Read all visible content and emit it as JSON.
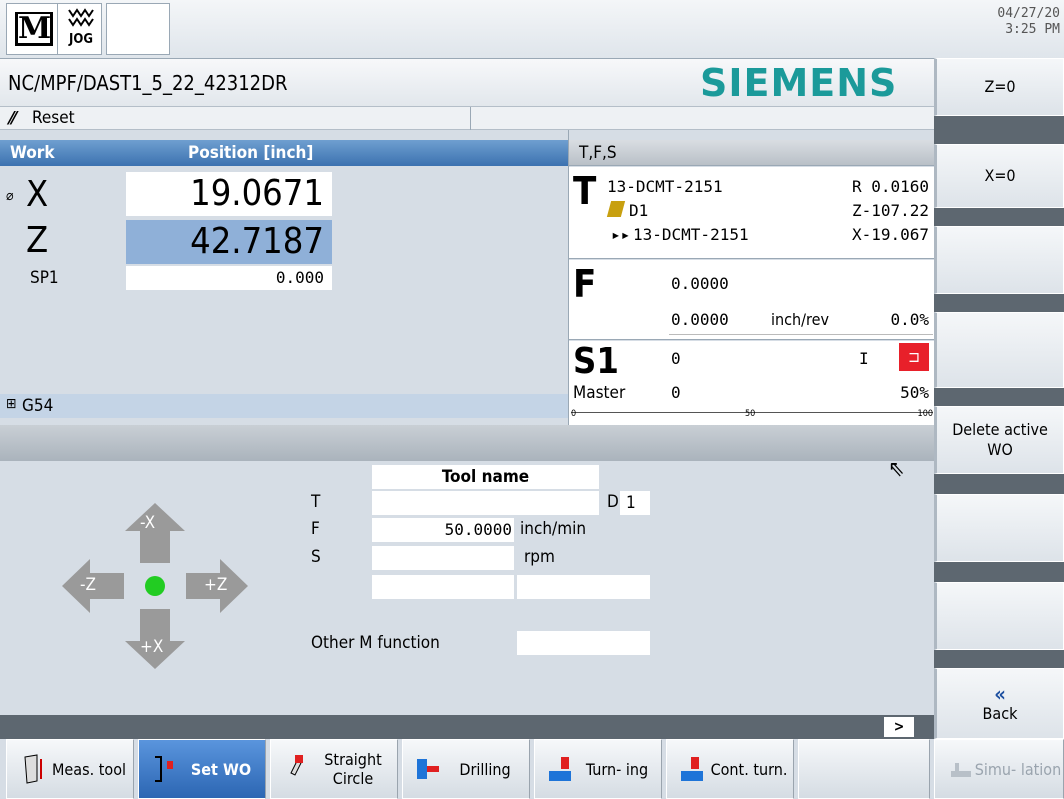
{
  "top": {
    "mode_icon": "M",
    "jog_label": "JOG",
    "date": "04/27/20",
    "time": "3:25 PM"
  },
  "program": {
    "path": "NC/MPF/DAST1_5_22_42312DR",
    "brand": "SIEMENS",
    "status": "Reset"
  },
  "position": {
    "header_work": "Work",
    "header_pos": "Position [inch]",
    "axes": [
      {
        "name": "X",
        "value": "19.0671",
        "marker": "⌀"
      },
      {
        "name": "Z",
        "value": "42.7187"
      }
    ],
    "spindle_label": "SP1",
    "spindle_value": "0.000",
    "wo": "G54"
  },
  "tfs": {
    "header": "T,F,S",
    "t_label": "T",
    "tool": "13-DCMT-2151",
    "d": "D1",
    "next_tool": "13-DCMT-2151",
    "r": "R 0.0160",
    "z": "Z-107.22",
    "x": "X-19.067",
    "f_label": "F",
    "f1": "0.0000",
    "f2": "0.0000",
    "f_unit": "inch/rev",
    "f_pct": "0.0%",
    "s_label": "S1",
    "s_val": "0",
    "s_dir": "I",
    "master_label": "Master",
    "master_val": "0",
    "master_pct": "50%",
    "scale": [
      "0",
      "50",
      "100"
    ]
  },
  "form": {
    "tool_name_header": "Tool name",
    "t": "T",
    "d_label": "D",
    "d_value": "1",
    "f": "F",
    "f_value": "50.0000",
    "f_unit": "inch/min",
    "s": "S",
    "s_unit": "rpm",
    "other_m": "Other M function",
    "arrows": {
      "up": "-X",
      "down": "+X",
      "left": "-Z",
      "right": "+Z"
    }
  },
  "right_softkeys": [
    "Z=0",
    "X=0",
    "",
    "",
    "Delete active WO",
    "",
    "",
    "Back"
  ],
  "bottom_softkeys": [
    {
      "label": "Meas. tool",
      "selected": false
    },
    {
      "label": "Set WO",
      "selected": true
    },
    {
      "label": "Straight Circle",
      "selected": false
    },
    {
      "label": "Drilling",
      "selected": false
    },
    {
      "label": "Turn- ing",
      "selected": false
    },
    {
      "label": "Cont. turn.",
      "selected": false
    },
    {
      "label": "",
      "selected": false
    },
    {
      "label": "Simu- lation",
      "selected": false,
      "disabled": true
    }
  ],
  "colors": {
    "header_blue": "#3c72b0",
    "selected_blue": "#2c66b3",
    "alarm_red": "#e8202a",
    "dot_green": "#22cc22"
  }
}
